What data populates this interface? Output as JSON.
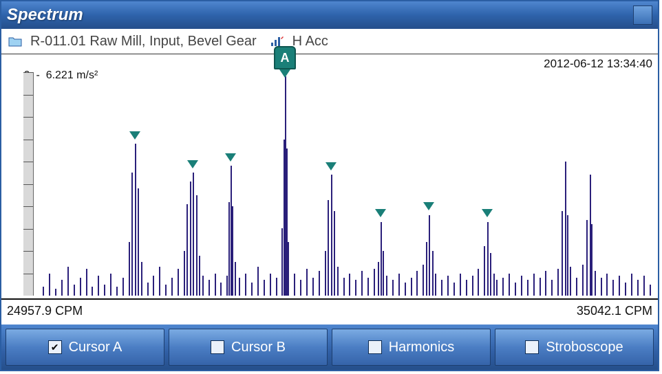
{
  "window": {
    "title": "Spectrum"
  },
  "info": {
    "path": "R-011.01 Raw Mill, Input, Bevel Gear",
    "channel": "H Acc"
  },
  "timestamp": "2012-06-12 13:34:40",
  "yaxis": {
    "min_label": "0",
    "dash": "-",
    "max_label": "6.221 m/s²",
    "ticks": 10
  },
  "xaxis": {
    "left": "24957.9 CPM",
    "right": "35042.1 CPM"
  },
  "cursor_badge": "A",
  "buttons": {
    "a": {
      "label": "Cursor A",
      "checked": true
    },
    "b": {
      "label": "Cursor B",
      "checked": false
    },
    "h": {
      "label": "Harmonics",
      "checked": false
    },
    "s": {
      "label": "Stroboscope",
      "checked": false
    }
  },
  "chart_data": {
    "type": "bar",
    "title": "Spectrum",
    "xlabel": "CPM",
    "ylabel": "m/s²",
    "xlim": [
      24957.9,
      35042.1
    ],
    "ylim": [
      0,
      6.221
    ],
    "cursor_A_cpm": 29000,
    "harmonic_markers_cpm": [
      26550,
      27500,
      28110,
      29750,
      30565,
      31350,
      32300
    ],
    "series": [
      {
        "name": "H Acc",
        "x_cpm": [
          25050,
          25150,
          25250,
          25350,
          25450,
          25550,
          25650,
          25750,
          25850,
          25950,
          26050,
          26150,
          26250,
          26350,
          26450,
          26500,
          26550,
          26600,
          26650,
          26750,
          26850,
          26950,
          27050,
          27150,
          27250,
          27350,
          27400,
          27450,
          27500,
          27550,
          27600,
          27650,
          27750,
          27850,
          27950,
          28050,
          28080,
          28110,
          28140,
          28180,
          28250,
          28350,
          28450,
          28550,
          28650,
          28750,
          28850,
          28950,
          28980,
          29000,
          29020,
          29050,
          29150,
          29250,
          29350,
          29450,
          29550,
          29650,
          29700,
          29750,
          29800,
          29850,
          29950,
          30050,
          30150,
          30250,
          30350,
          30450,
          30520,
          30565,
          30600,
          30650,
          30750,
          30850,
          30950,
          31050,
          31150,
          31250,
          31300,
          31350,
          31400,
          31450,
          31550,
          31650,
          31750,
          31850,
          31950,
          32050,
          32150,
          32250,
          32300,
          32350,
          32400,
          32450,
          32550,
          32650,
          32750,
          32850,
          32950,
          33050,
          33150,
          33250,
          33350,
          33450,
          33520,
          33570,
          33600,
          33650,
          33750,
          33850,
          33920,
          33970,
          34000,
          34050,
          34150,
          34250,
          34350,
          34450,
          34550,
          34650,
          34750,
          34850,
          34950
        ],
        "y_ms2": [
          0.25,
          0.62,
          0.19,
          0.44,
          0.81,
          0.31,
          0.5,
          0.75,
          0.25,
          0.56,
          0.31,
          0.62,
          0.25,
          0.5,
          1.49,
          3.42,
          4.23,
          2.99,
          0.93,
          0.37,
          0.56,
          0.81,
          0.31,
          0.5,
          0.75,
          1.24,
          2.55,
          3.17,
          3.42,
          2.8,
          1.12,
          0.56,
          0.44,
          0.62,
          0.37,
          0.56,
          2.61,
          3.61,
          2.49,
          0.93,
          0.5,
          0.62,
          0.37,
          0.81,
          0.44,
          0.62,
          0.5,
          1.87,
          4.35,
          6.1,
          4.1,
          1.49,
          0.62,
          0.44,
          0.75,
          0.5,
          0.68,
          1.24,
          2.67,
          3.36,
          2.36,
          0.81,
          0.5,
          0.62,
          0.44,
          0.68,
          0.5,
          0.75,
          0.93,
          2.05,
          1.24,
          0.56,
          0.44,
          0.62,
          0.37,
          0.5,
          0.68,
          0.87,
          1.49,
          2.24,
          1.24,
          0.62,
          0.44,
          0.56,
          0.37,
          0.62,
          0.44,
          0.56,
          0.75,
          1.37,
          2.05,
          1.18,
          0.62,
          0.44,
          0.5,
          0.62,
          0.37,
          0.56,
          0.44,
          0.62,
          0.5,
          0.68,
          0.44,
          0.75,
          2.36,
          3.73,
          2.24,
          0.81,
          0.5,
          0.87,
          2.11,
          3.36,
          1.99,
          0.68,
          0.5,
          0.62,
          0.44,
          0.56,
          0.37,
          0.62,
          0.44,
          0.56,
          0.31
        ]
      }
    ]
  }
}
